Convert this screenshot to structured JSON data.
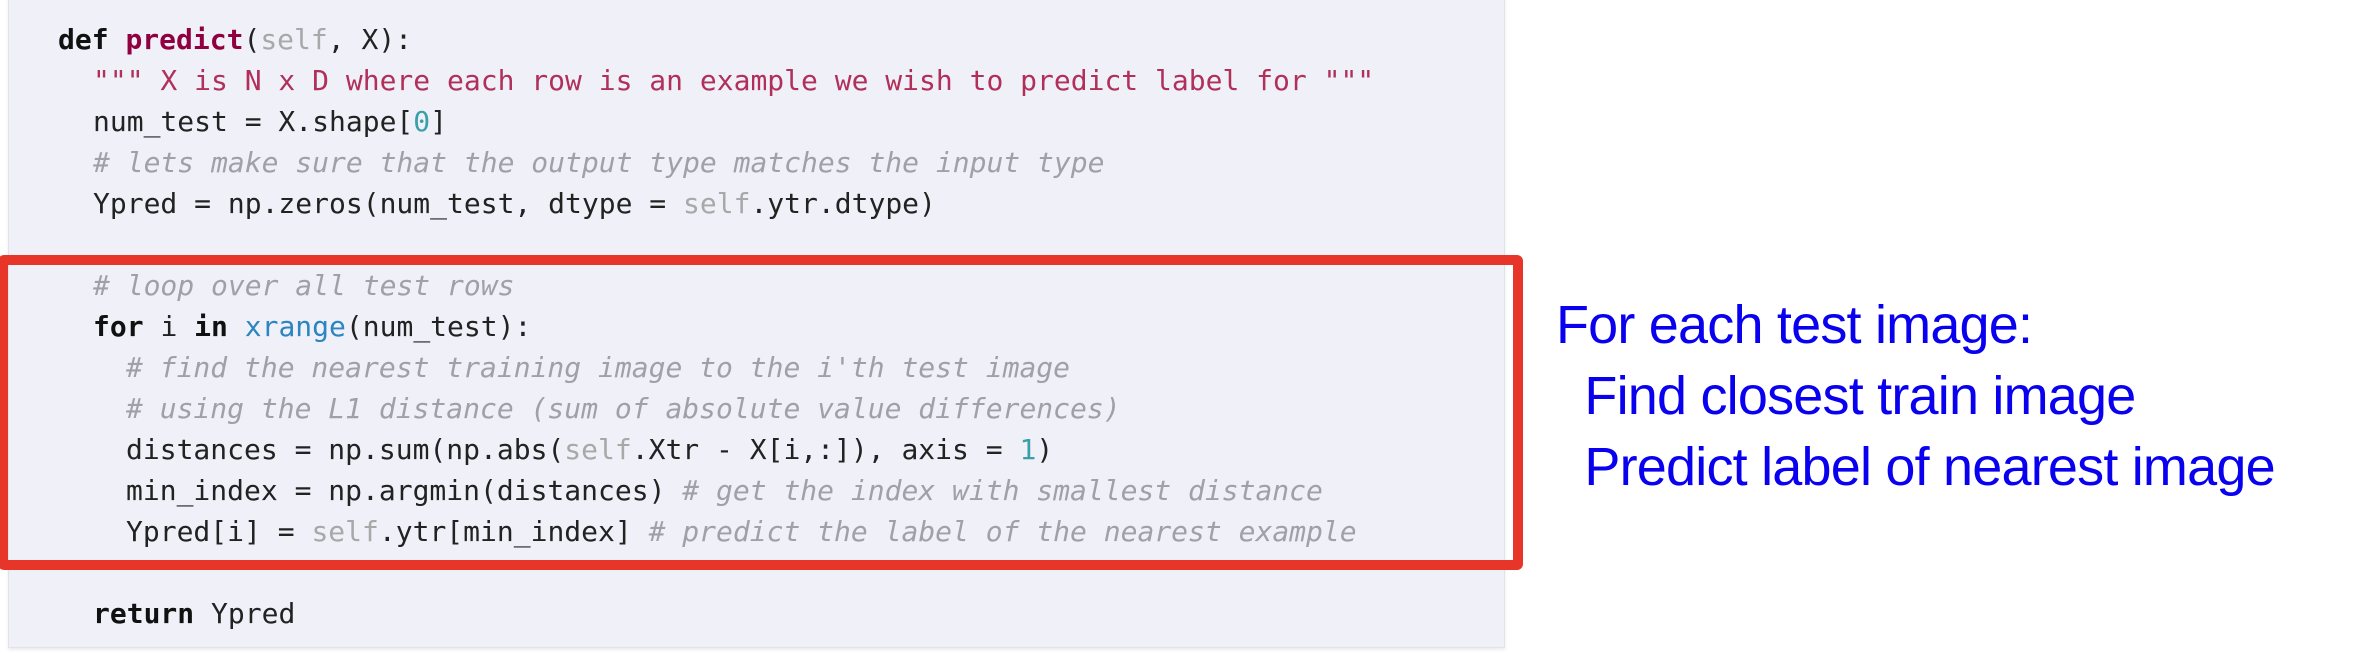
{
  "code": {
    "lines": [
      {
        "indent": 0,
        "segments": [
          {
            "t": "kw",
            "s": "def "
          },
          {
            "t": "fn",
            "s": "predict"
          },
          {
            "t": "plain",
            "s": "("
          },
          {
            "t": "self",
            "s": "self"
          },
          {
            "t": "plain",
            "s": ", X):"
          }
        ]
      },
      {
        "indent": 1,
        "segments": [
          {
            "t": "str",
            "s": "\"\"\" X is N x D where each row is an example we wish to predict label for \"\"\""
          }
        ]
      },
      {
        "indent": 1,
        "segments": [
          {
            "t": "plain",
            "s": "num_test = X.shape["
          },
          {
            "t": "num",
            "s": "0"
          },
          {
            "t": "plain",
            "s": "]"
          }
        ]
      },
      {
        "indent": 1,
        "segments": [
          {
            "t": "com",
            "s": "# lets make sure that the output type matches the input type"
          }
        ]
      },
      {
        "indent": 1,
        "segments": [
          {
            "t": "plain",
            "s": "Ypred = np.zeros(num_test, dtype = "
          },
          {
            "t": "self",
            "s": "self"
          },
          {
            "t": "plain",
            "s": ".ytr.dtype)"
          }
        ]
      },
      {
        "indent": 1,
        "segments": []
      },
      {
        "indent": 1,
        "segments": [
          {
            "t": "com",
            "s": "# loop over all test rows"
          }
        ]
      },
      {
        "indent": 1,
        "segments": [
          {
            "t": "kw",
            "s": "for "
          },
          {
            "t": "plain",
            "s": "i "
          },
          {
            "t": "kw",
            "s": "in "
          },
          {
            "t": "builtin",
            "s": "xrange"
          },
          {
            "t": "plain",
            "s": "(num_test):"
          }
        ]
      },
      {
        "indent": 2,
        "segments": [
          {
            "t": "com",
            "s": "# find the nearest training image to the i'th test image"
          }
        ]
      },
      {
        "indent": 2,
        "segments": [
          {
            "t": "com",
            "s": "# using the L1 distance (sum of absolute value differences)"
          }
        ]
      },
      {
        "indent": 2,
        "segments": [
          {
            "t": "plain",
            "s": "distances = np.sum(np.abs("
          },
          {
            "t": "self",
            "s": "self"
          },
          {
            "t": "plain",
            "s": ".Xtr - X[i,:]), axis = "
          },
          {
            "t": "num",
            "s": "1"
          },
          {
            "t": "plain",
            "s": ")"
          }
        ]
      },
      {
        "indent": 2,
        "segments": [
          {
            "t": "plain",
            "s": "min_index = np.argmin(distances) "
          },
          {
            "t": "com",
            "s": "# get the index with smallest distance"
          }
        ]
      },
      {
        "indent": 2,
        "segments": [
          {
            "t": "plain",
            "s": "Ypred[i] = "
          },
          {
            "t": "self",
            "s": "self"
          },
          {
            "t": "plain",
            "s": ".ytr[min_index] "
          },
          {
            "t": "com",
            "s": "# predict the label of the nearest example"
          }
        ]
      },
      {
        "indent": 1,
        "segments": []
      },
      {
        "indent": 1,
        "segments": [
          {
            "t": "kw",
            "s": "return "
          },
          {
            "t": "plain",
            "s": "Ypred"
          }
        ]
      }
    ]
  },
  "annotation": {
    "lines": [
      "For each test image:",
      "  Find closest train image",
      "  Predict label of nearest image"
    ],
    "color": "#0a00f0"
  },
  "highlight_color": "#e8352a"
}
